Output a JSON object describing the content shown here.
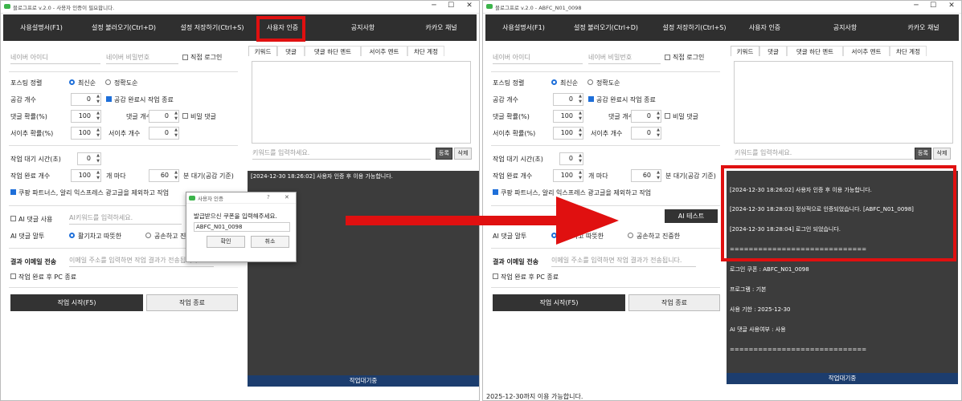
{
  "menu": [
    "사용설명서(F1)",
    "설정 불러오기(Ctrl+D)",
    "설정 저장하기(Ctrl+S)",
    "사용자 인증",
    "공지사항",
    "카카오 채널"
  ],
  "left": {
    "title": "블로그프로 v.2.0 - 사용자 인증이 필요합니다.",
    "log_lines": [
      "[2024-12-30 18:26:02] 사용자 인증 후 이용 가능합니다."
    ],
    "ai_keyword_placeholder": "AI키워드를 입력하세요."
  },
  "right": {
    "title": "블로그프로 v.2.0 - ABFC_N01_0098",
    "log_lines": [
      "[2024-12-30 18:26:02] 사용자 인증 후 이용 가능합니다.",
      "[2024-12-30 18:28:03] 정상적으로 인증되었습니다. [ABFC_N01_0098]",
      "[2024-12-30 18:28:04] 로그인 되었습니다.",
      "=============================",
      "로그인 쿠폰 : ABFC_N01_0098",
      "프로그램 : 기본",
      "사용 기한 : 2025-12-30",
      "AI 댓글 사용여부 : 사용",
      "============================="
    ],
    "ai_test_button": "AI 테스트",
    "footer": "2025-12-30까지 이용 가능합니다."
  },
  "form": {
    "naver_id": "네이버 아이디",
    "naver_pw": "네이버 비밀번호",
    "direct_login": "직접 로그인",
    "posting_order": "포스팅 정렬",
    "latest": "최신순",
    "accuracy": "정확도순",
    "like_count": "공감 개수",
    "like_count_val": "0",
    "stop_on_like": "공감 완료시 작업 종료",
    "comment_prob": "댓글 확률(%)",
    "comment_prob_val": "100",
    "comment_count": "댓글 개수",
    "comment_count_val": "0",
    "secret_comment": "비밀 댓글",
    "neighbor_prob": "서이추 확률(%)",
    "neighbor_prob_val": "100",
    "neighbor_count": "서이추 개수",
    "neighbor_count_val": "0",
    "wait_time": "작업 대기 시간(초)",
    "wait_time_val": "0",
    "done_count": "작업 완료 개수",
    "done_count_val": "100",
    "per": "개 마다",
    "per_min_val": "60",
    "min_wait": "분 대기(공감 기준)",
    "exclude_ads": "쿠팡 파트너스, 알리 익스프레스 광고글을 제외하고 작업",
    "ai_comment_use": "AI 댓글 사용",
    "ai_comment_tone": "AI 댓글 말투",
    "tone_warm": "활기차고 따뜻한",
    "tone_polite": "공손하고 진중한",
    "email_label": "결과 이메일 전송",
    "email_placeholder": "이메일 주소를 입력하면 작업 결과가 전송됩니다.",
    "shutdown_pc": "작업 완료 후 PC 종료",
    "start_button": "작업 시작(F5)",
    "stop_button": "작업 종료"
  },
  "tabs": [
    "키워드",
    "댓글",
    "댓글 하단 멘트",
    "서이추 멘트",
    "차단 계정"
  ],
  "keyword_placeholder": "키워드를 입력하세요.",
  "register_button": "등록",
  "delete_button": "삭제",
  "status_text": "작업대기중",
  "dialog": {
    "title": "사용자 인증",
    "help": "?",
    "close": "✕",
    "message": "발급받으신 쿠폰을 입력해주세요.",
    "coupon": "ABFC_N01_0098",
    "ok": "확인",
    "cancel": "취소"
  },
  "window_controls": [
    "─",
    "☐",
    "✕"
  ]
}
